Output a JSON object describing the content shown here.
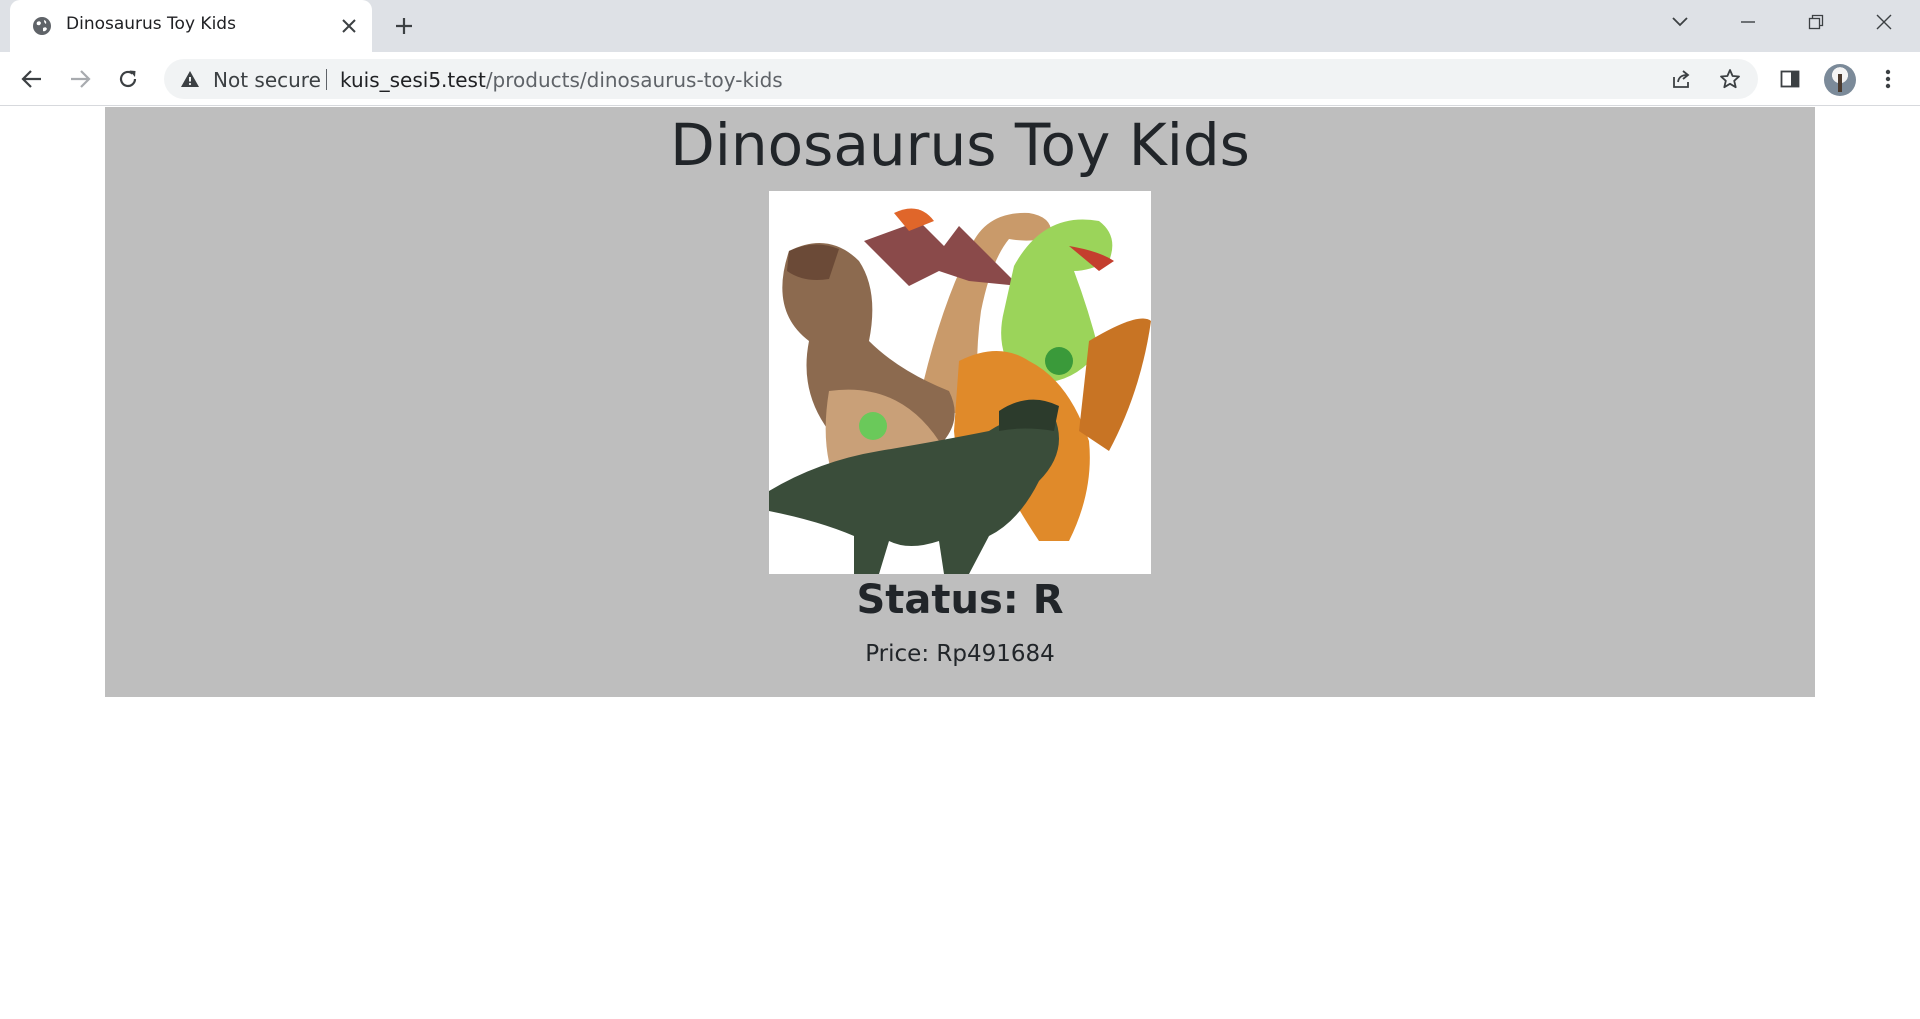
{
  "browser": {
    "tab_title": "Dinosaurus Toy Kids",
    "security_label": "Not secure",
    "url_host": "kuis_sesi5.test",
    "url_path": "/products/dinosaurus-toy-kids"
  },
  "product": {
    "title": "Dinosaurus Toy Kids",
    "status": "Status: R",
    "price": "Price: Rp491684",
    "image_icon": "dinosaur-toys-photo"
  },
  "colors": {
    "tabstrip_bg": "#dee1e6",
    "card_bg": "#bebebe",
    "text": "#212529"
  }
}
